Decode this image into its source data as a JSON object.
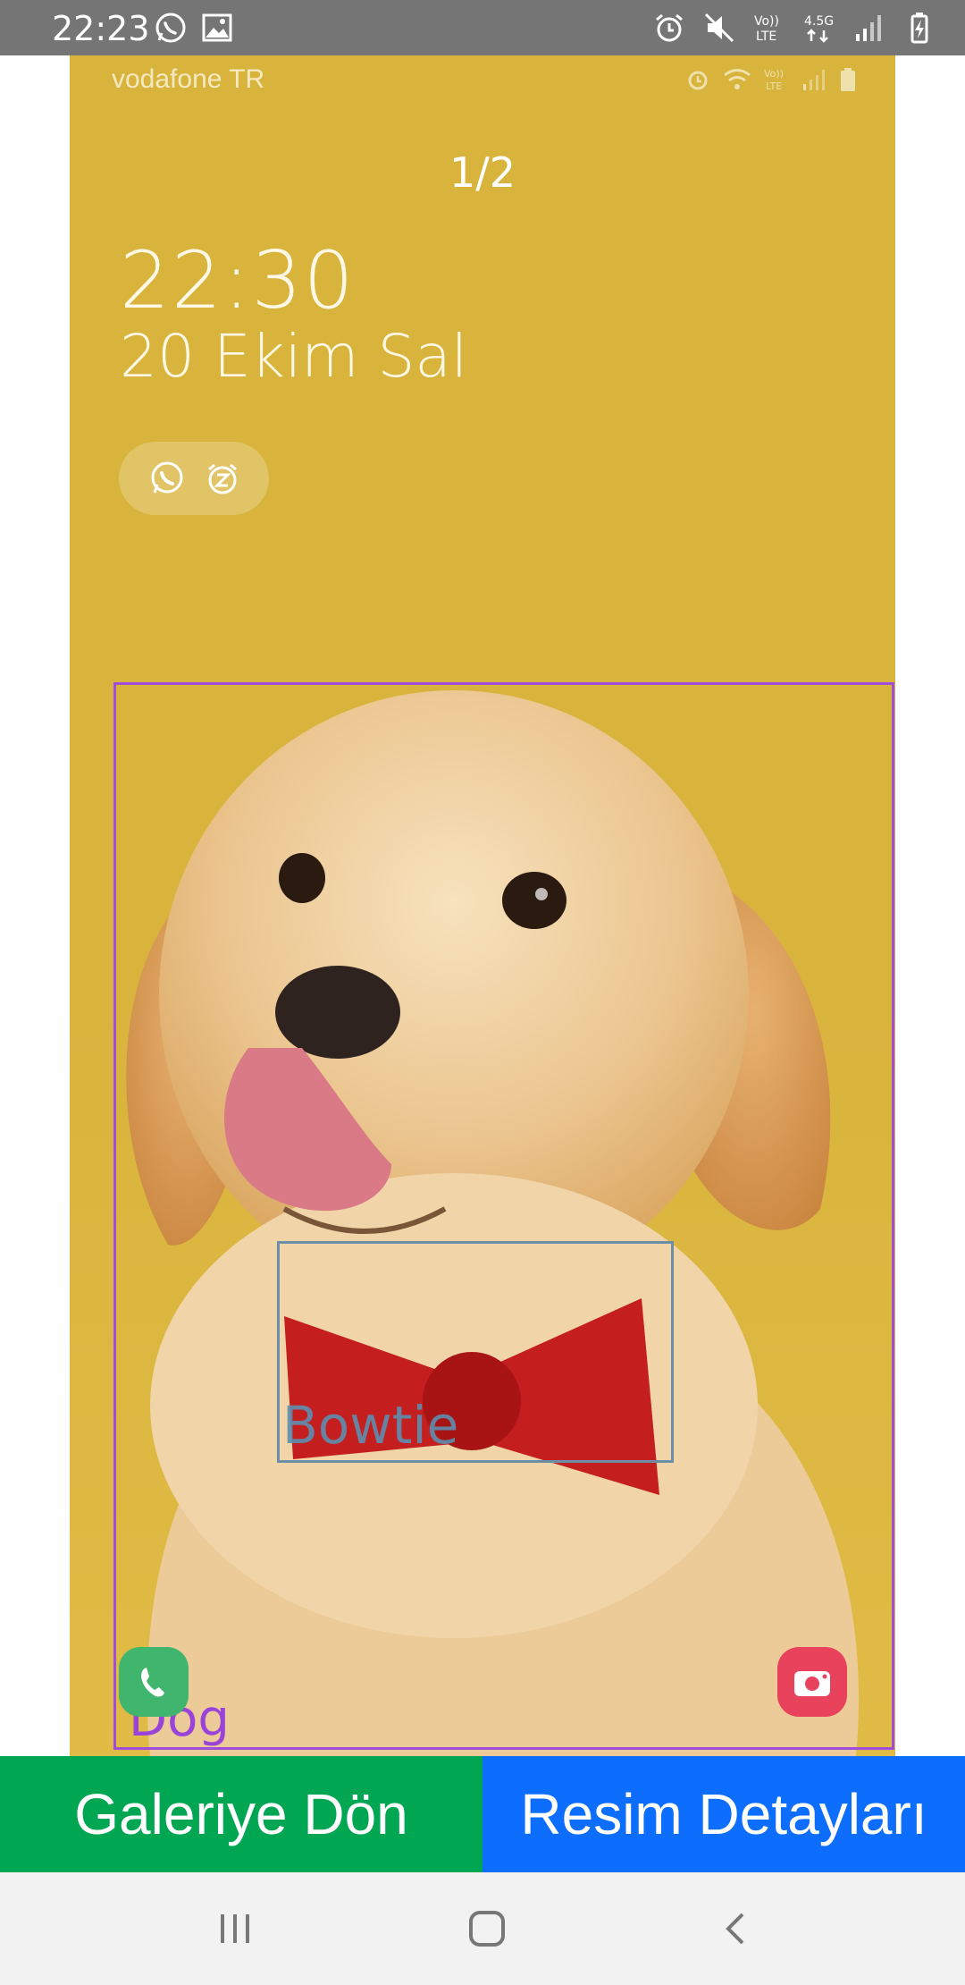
{
  "status_bar": {
    "time": "22:23",
    "left_icons": [
      "whatsapp-icon",
      "image-icon"
    ],
    "right_icons": [
      "alarm-icon",
      "mute-icon",
      "volte-icon",
      "network-4.5g-icon",
      "signal-icon",
      "battery-charging-icon"
    ],
    "volte_text": "Vo)) LTE",
    "network_text": "4.5G"
  },
  "screenshot": {
    "carrier": "vodafone TR",
    "page_counter": "1/2",
    "lock_time": "22:30",
    "lock_date": "20 Ekim Sal",
    "notification_icons": [
      "whatsapp-icon",
      "alarm-snooze-icon"
    ]
  },
  "detections": [
    {
      "label": "Dog",
      "color": "#a04ddb"
    },
    {
      "label": "Bowtie",
      "color": "#6c8fa7"
    }
  ],
  "buttons": {
    "gallery": "Galeriye Dön",
    "details": "Resim Detayları"
  },
  "colors": {
    "gallery_button": "#00a651",
    "details_button": "#0d6efd",
    "background_yellow": "#d9b43d"
  },
  "nav_bar": {
    "items": [
      "recents-icon",
      "home-icon",
      "back-icon"
    ]
  }
}
